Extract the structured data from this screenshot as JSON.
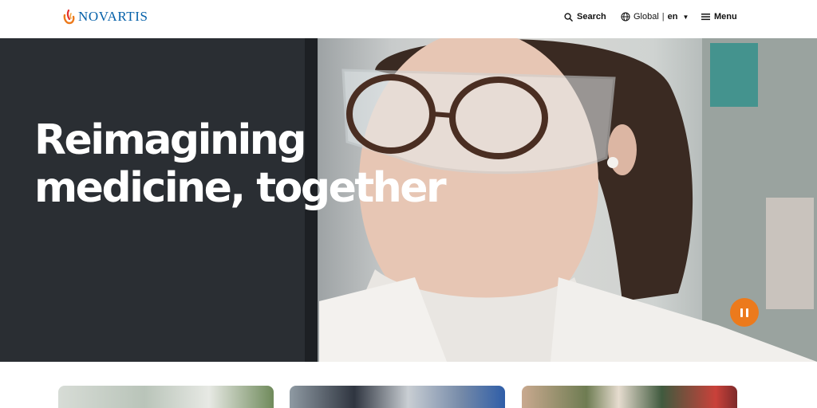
{
  "header": {
    "logo_text": "NOVARTIS",
    "search_label": "Search",
    "region_label": "Global",
    "language_code": "en",
    "menu_label": "Menu"
  },
  "hero": {
    "title_line1": "Reimagining",
    "title_line2": "medicine, together",
    "pause_control": "pause-icon"
  },
  "colors": {
    "brand_blue": "#0460a9",
    "accent_orange": "#ec7a1c"
  },
  "cards": [
    {
      "icon": "image"
    },
    {
      "icon": "image"
    },
    {
      "icon": "image"
    }
  ]
}
